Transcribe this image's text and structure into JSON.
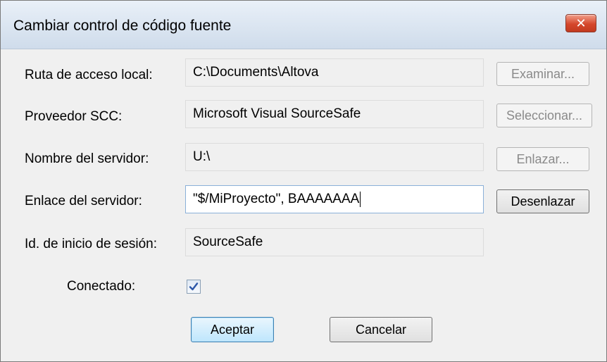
{
  "dialog": {
    "title": "Cambiar control de código fuente",
    "close_glyph": "✕"
  },
  "fields": [
    {
      "label": "Ruta de acceso local:",
      "value": "C:\\Documents\\Altova",
      "button": "Examinar...",
      "button_enabled": false
    },
    {
      "label": "Proveedor SCC:",
      "value": "Microsoft Visual SourceSafe",
      "button": "Seleccionar...",
      "button_enabled": false
    },
    {
      "label": "Nombre del servidor:",
      "value": "U:\\",
      "button": "Enlazar...",
      "button_enabled": false
    },
    {
      "label": "Enlace del servidor:",
      "value": "\"$/MiProyecto\", BAAAAAAA",
      "button": "Desenlazar",
      "button_enabled": true
    },
    {
      "label": "Id. de inicio de sesión:",
      "value": "SourceSafe"
    }
  ],
  "connected": {
    "label": "Conectado:",
    "checked": true
  },
  "actions": {
    "ok": "Aceptar",
    "cancel": "Cancelar"
  },
  "colors": {
    "checkmark": "#2b56a8",
    "default_button_border": "#3c7fb1"
  },
  "icons": {
    "close": "close-icon",
    "check": "checkmark-icon"
  }
}
